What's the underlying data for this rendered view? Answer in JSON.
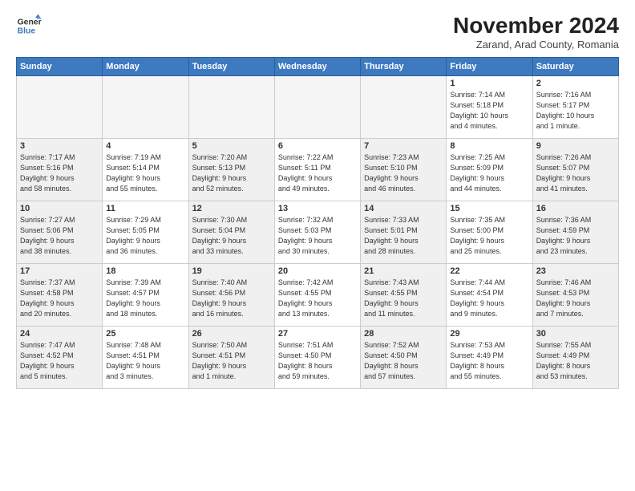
{
  "logo": {
    "line1": "General",
    "line2": "Blue"
  },
  "title": "November 2024",
  "subtitle": "Zarand, Arad County, Romania",
  "weekdays": [
    "Sunday",
    "Monday",
    "Tuesday",
    "Wednesday",
    "Thursday",
    "Friday",
    "Saturday"
  ],
  "weeks": [
    [
      {
        "day": "",
        "info": "",
        "shaded": true
      },
      {
        "day": "",
        "info": "",
        "shaded": true
      },
      {
        "day": "",
        "info": "",
        "shaded": true
      },
      {
        "day": "",
        "info": "",
        "shaded": true
      },
      {
        "day": "",
        "info": "",
        "shaded": true
      },
      {
        "day": "1",
        "info": "Sunrise: 7:14 AM\nSunset: 5:18 PM\nDaylight: 10 hours\nand 4 minutes.",
        "shaded": false
      },
      {
        "day": "2",
        "info": "Sunrise: 7:16 AM\nSunset: 5:17 PM\nDaylight: 10 hours\nand 1 minute.",
        "shaded": false
      }
    ],
    [
      {
        "day": "3",
        "info": "Sunrise: 7:17 AM\nSunset: 5:16 PM\nDaylight: 9 hours\nand 58 minutes.",
        "shaded": true
      },
      {
        "day": "4",
        "info": "Sunrise: 7:19 AM\nSunset: 5:14 PM\nDaylight: 9 hours\nand 55 minutes.",
        "shaded": false
      },
      {
        "day": "5",
        "info": "Sunrise: 7:20 AM\nSunset: 5:13 PM\nDaylight: 9 hours\nand 52 minutes.",
        "shaded": true
      },
      {
        "day": "6",
        "info": "Sunrise: 7:22 AM\nSunset: 5:11 PM\nDaylight: 9 hours\nand 49 minutes.",
        "shaded": false
      },
      {
        "day": "7",
        "info": "Sunrise: 7:23 AM\nSunset: 5:10 PM\nDaylight: 9 hours\nand 46 minutes.",
        "shaded": true
      },
      {
        "day": "8",
        "info": "Sunrise: 7:25 AM\nSunset: 5:09 PM\nDaylight: 9 hours\nand 44 minutes.",
        "shaded": false
      },
      {
        "day": "9",
        "info": "Sunrise: 7:26 AM\nSunset: 5:07 PM\nDaylight: 9 hours\nand 41 minutes.",
        "shaded": true
      }
    ],
    [
      {
        "day": "10",
        "info": "Sunrise: 7:27 AM\nSunset: 5:06 PM\nDaylight: 9 hours\nand 38 minutes.",
        "shaded": true
      },
      {
        "day": "11",
        "info": "Sunrise: 7:29 AM\nSunset: 5:05 PM\nDaylight: 9 hours\nand 36 minutes.",
        "shaded": false
      },
      {
        "day": "12",
        "info": "Sunrise: 7:30 AM\nSunset: 5:04 PM\nDaylight: 9 hours\nand 33 minutes.",
        "shaded": true
      },
      {
        "day": "13",
        "info": "Sunrise: 7:32 AM\nSunset: 5:03 PM\nDaylight: 9 hours\nand 30 minutes.",
        "shaded": false
      },
      {
        "day": "14",
        "info": "Sunrise: 7:33 AM\nSunset: 5:01 PM\nDaylight: 9 hours\nand 28 minutes.",
        "shaded": true
      },
      {
        "day": "15",
        "info": "Sunrise: 7:35 AM\nSunset: 5:00 PM\nDaylight: 9 hours\nand 25 minutes.",
        "shaded": false
      },
      {
        "day": "16",
        "info": "Sunrise: 7:36 AM\nSunset: 4:59 PM\nDaylight: 9 hours\nand 23 minutes.",
        "shaded": true
      }
    ],
    [
      {
        "day": "17",
        "info": "Sunrise: 7:37 AM\nSunset: 4:58 PM\nDaylight: 9 hours\nand 20 minutes.",
        "shaded": true
      },
      {
        "day": "18",
        "info": "Sunrise: 7:39 AM\nSunset: 4:57 PM\nDaylight: 9 hours\nand 18 minutes.",
        "shaded": false
      },
      {
        "day": "19",
        "info": "Sunrise: 7:40 AM\nSunset: 4:56 PM\nDaylight: 9 hours\nand 16 minutes.",
        "shaded": true
      },
      {
        "day": "20",
        "info": "Sunrise: 7:42 AM\nSunset: 4:55 PM\nDaylight: 9 hours\nand 13 minutes.",
        "shaded": false
      },
      {
        "day": "21",
        "info": "Sunrise: 7:43 AM\nSunset: 4:55 PM\nDaylight: 9 hours\nand 11 minutes.",
        "shaded": true
      },
      {
        "day": "22",
        "info": "Sunrise: 7:44 AM\nSunset: 4:54 PM\nDaylight: 9 hours\nand 9 minutes.",
        "shaded": false
      },
      {
        "day": "23",
        "info": "Sunrise: 7:46 AM\nSunset: 4:53 PM\nDaylight: 9 hours\nand 7 minutes.",
        "shaded": true
      }
    ],
    [
      {
        "day": "24",
        "info": "Sunrise: 7:47 AM\nSunset: 4:52 PM\nDaylight: 9 hours\nand 5 minutes.",
        "shaded": true
      },
      {
        "day": "25",
        "info": "Sunrise: 7:48 AM\nSunset: 4:51 PM\nDaylight: 9 hours\nand 3 minutes.",
        "shaded": false
      },
      {
        "day": "26",
        "info": "Sunrise: 7:50 AM\nSunset: 4:51 PM\nDaylight: 9 hours\nand 1 minute.",
        "shaded": true
      },
      {
        "day": "27",
        "info": "Sunrise: 7:51 AM\nSunset: 4:50 PM\nDaylight: 8 hours\nand 59 minutes.",
        "shaded": false
      },
      {
        "day": "28",
        "info": "Sunrise: 7:52 AM\nSunset: 4:50 PM\nDaylight: 8 hours\nand 57 minutes.",
        "shaded": true
      },
      {
        "day": "29",
        "info": "Sunrise: 7:53 AM\nSunset: 4:49 PM\nDaylight: 8 hours\nand 55 minutes.",
        "shaded": false
      },
      {
        "day": "30",
        "info": "Sunrise: 7:55 AM\nSunset: 4:49 PM\nDaylight: 8 hours\nand 53 minutes.",
        "shaded": true
      }
    ]
  ]
}
